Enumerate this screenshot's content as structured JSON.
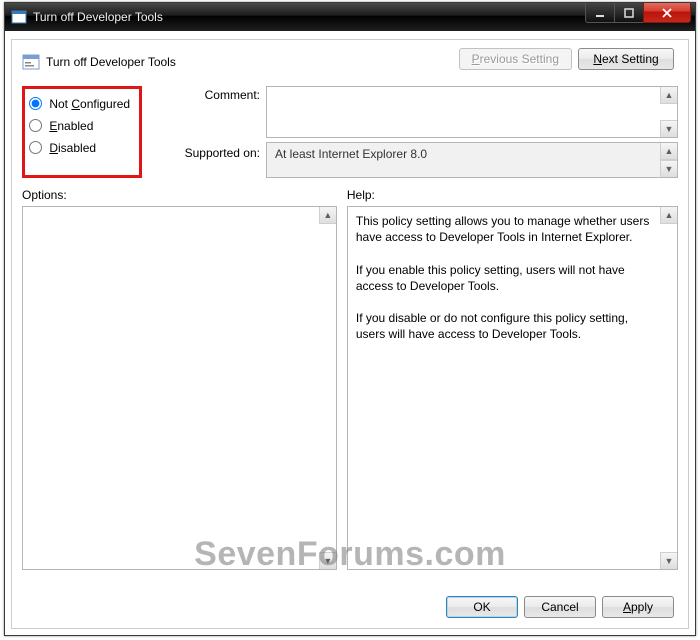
{
  "window": {
    "title": "Turn off Developer Tools"
  },
  "header": {
    "title": "Turn off Developer Tools",
    "prev_label": "Previous Setting",
    "next_label": "Next Setting"
  },
  "radios": {
    "not_configured": "Not Configured",
    "enabled": "Enabled",
    "disabled": "Disabled"
  },
  "labels": {
    "comment": "Comment:",
    "supported": "Supported on:",
    "options": "Options:",
    "help": "Help:"
  },
  "supported_text": "At least Internet Explorer 8.0",
  "help_text": {
    "p1": "This policy setting allows you to manage whether users have access to Developer Tools in Internet Explorer.",
    "p2": "If you enable this policy setting, users will not have access to Developer Tools.",
    "p3": "If you disable or do not configure this policy setting, users will have access to Developer Tools."
  },
  "buttons": {
    "ok": "OK",
    "cancel": "Cancel",
    "apply": "Apply"
  },
  "watermark": "SevenForums.com"
}
